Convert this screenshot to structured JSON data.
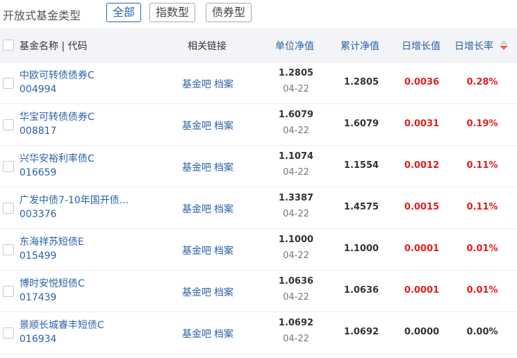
{
  "type_bar": {
    "title": "开放式基金类型",
    "buttons": [
      {
        "label": "全部",
        "active": true
      },
      {
        "label": "指数型",
        "active": false
      },
      {
        "label": "债券型",
        "active": false
      }
    ]
  },
  "header": {
    "name_code": "基金名称 | 代码",
    "links": "相关链接",
    "nav": "单位净值",
    "acc_nav": "累计净值",
    "daily_change": "日增长值",
    "daily_rate": "日增长率"
  },
  "colors": {
    "link_blue": "#2b62a9",
    "up_red": "#e01e1e",
    "sort_orange": "#e8693a"
  },
  "rows": [
    {
      "name": "中欧可转债债券C",
      "code": "004994",
      "bar": "基金吧",
      "archive": "档案",
      "nav": "1.2805",
      "date": "04-22",
      "acc": "1.2805",
      "chg": "0.0036",
      "pct": "0.28%",
      "dir": "up"
    },
    {
      "name": "华宝可转债债券C",
      "code": "008817",
      "bar": "基金吧",
      "archive": "档案",
      "nav": "1.6079",
      "date": "04-22",
      "acc": "1.6079",
      "chg": "0.0031",
      "pct": "0.19%",
      "dir": "up"
    },
    {
      "name": "兴华安裕利率债C",
      "code": "016659",
      "bar": "基金吧",
      "archive": "档案",
      "nav": "1.1074",
      "date": "04-22",
      "acc": "1.1554",
      "chg": "0.0012",
      "pct": "0.11%",
      "dir": "up"
    },
    {
      "name": "广发中债7-10年国开债...",
      "code": "003376",
      "bar": "基金吧",
      "archive": "档案",
      "nav": "1.3387",
      "date": "04-22",
      "acc": "1.4575",
      "chg": "0.0015",
      "pct": "0.11%",
      "dir": "up"
    },
    {
      "name": "东海祥苏短债E",
      "code": "015499",
      "bar": "基金吧",
      "archive": "档案",
      "nav": "1.1000",
      "date": "04-22",
      "acc": "1.1000",
      "chg": "0.0001",
      "pct": "0.01%",
      "dir": "up"
    },
    {
      "name": "博时安悦短债C",
      "code": "017439",
      "bar": "基金吧",
      "archive": "档案",
      "nav": "1.0636",
      "date": "04-22",
      "acc": "1.0636",
      "chg": "0.0001",
      "pct": "0.01%",
      "dir": "up"
    },
    {
      "name": "景顺长城睿丰短债C",
      "code": "016934",
      "bar": "基金吧",
      "archive": "档案",
      "nav": "1.0692",
      "date": "04-22",
      "acc": "1.0692",
      "chg": "0.0000",
      "pct": "0.00%",
      "dir": "flat"
    }
  ]
}
